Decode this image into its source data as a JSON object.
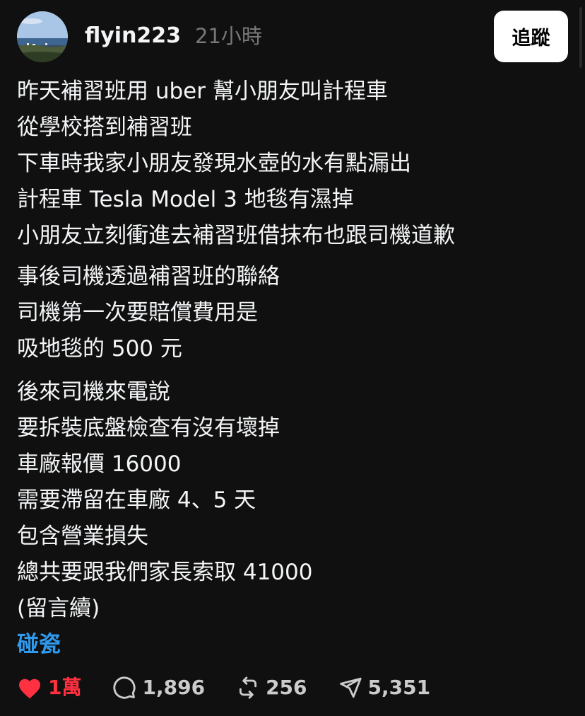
{
  "header": {
    "username": "flyin223",
    "timestamp": "21小時",
    "follow_label": "追蹤"
  },
  "post": {
    "paragraphs": [
      [
        "昨天補習班用 uber 幫小朋友叫計程車",
        "從學校搭到補習班",
        "下車時我家小朋友發現水壺的水有點漏出",
        "計程車 Tesla Model 3 地毯有濕掉",
        "小朋友立刻衝進去補習班借抹布也跟司機道歉"
      ],
      [
        "事後司機透過補習班的聯絡",
        "司機第一次要賠償費用是",
        "吸地毯的 500 元"
      ],
      [
        "後來司機來電說",
        "要拆裝底盤檢查有沒有壞掉",
        "車廠報價 16000",
        "需要滯留在車廠 4、5 天",
        "包含營業損失",
        "總共要跟我們家長索取 41000",
        "(留言續)"
      ]
    ],
    "topic_tag": "碰瓷"
  },
  "actions": {
    "likes": "1萬",
    "comments": "1,896",
    "reposts": "256",
    "shares": "5,351",
    "like_color": "#ff3040"
  },
  "icons": {
    "like": "heart-filled-icon",
    "comment": "comment-bubble-icon",
    "repost": "repost-icon",
    "share": "send-icon"
  }
}
